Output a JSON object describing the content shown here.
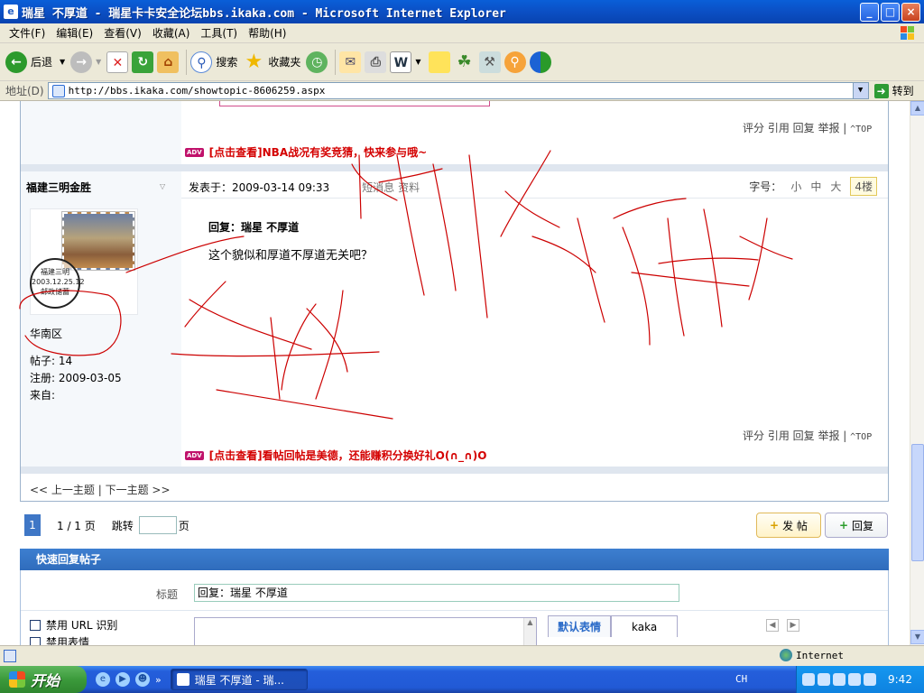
{
  "window": {
    "title": "瑞星 不厚道 - 瑞星卡卡安全论坛bbs.ikaka.com - Microsoft Internet Explorer",
    "controls": {
      "minimize": "_",
      "maximize": "□",
      "close": "×"
    }
  },
  "menu": {
    "items": [
      "文件(F)",
      "编辑(E)",
      "查看(V)",
      "收藏(A)",
      "工具(T)",
      "帮助(H)"
    ]
  },
  "toolbar": {
    "back_label": "后退",
    "search_label": "搜索",
    "favorites_label": "收藏夹"
  },
  "address": {
    "label": "地址(D)",
    "url": "http://bbs.ikaka.com/showtopic-8606259.aspx",
    "go_label": "转到"
  },
  "post": {
    "prev_footer": {
      "actions": "评分 引用 回复 举报 |",
      "top": "^TOP"
    },
    "prev_ad": "[点击查看]NBA战况有奖竞猜，快来参与哦~",
    "author": "福建三明金胜",
    "posted_at": "发表于：2009-03-14 09:33",
    "msg_link": "短消息",
    "profile_link": "资料",
    "font_size": {
      "label": "字号：",
      "small": "小",
      "medium": "中",
      "large": "大",
      "floor": "4楼"
    },
    "postmark_text": "福建三明\n2003.12.25.12\n邮政储蓄",
    "region": "华南区",
    "posts_count": "帖子: 14",
    "registered": "注册: 2009-03-05",
    "from": "来自:",
    "reply_title": "回复：瑞星 不厚道",
    "reply_body": "这个貌似和厚道不厚道无关吧？",
    "footer": {
      "actions": "评分 引用 回复 举报 |",
      "top": "^TOP"
    },
    "ad": "[点击查看]看帖回帖是美德，还能赚积分换好礼O(∩_∩)O",
    "nav": "<< 上一主题 | 下一主题 >>"
  },
  "pager": {
    "current": "1",
    "total": "1 / 1 页",
    "jump_label": "跳转",
    "page_suffix": "页",
    "post_button": "发 帖",
    "reply_button": "回复"
  },
  "quick_reply": {
    "header": "快速回复帖子",
    "title_label": "标题",
    "title_value": "回复：瑞星 不厚道",
    "opt_disable_url": "禁用 URL 识别",
    "opt_disable_emoticon": "禁用表情",
    "emo_tab_default": "默认表情",
    "emo_tab_kaka": "kaka"
  },
  "status": {
    "zone": "Internet"
  },
  "taskbar": {
    "start": "开始",
    "task_item": "瑞星 不厚道 - 瑞...",
    "lang": "CH",
    "clock": "9:42"
  },
  "colors": {
    "accent": "#2f6cbc",
    "ad_red": "#d40000",
    "scribble": "#cc0000"
  }
}
